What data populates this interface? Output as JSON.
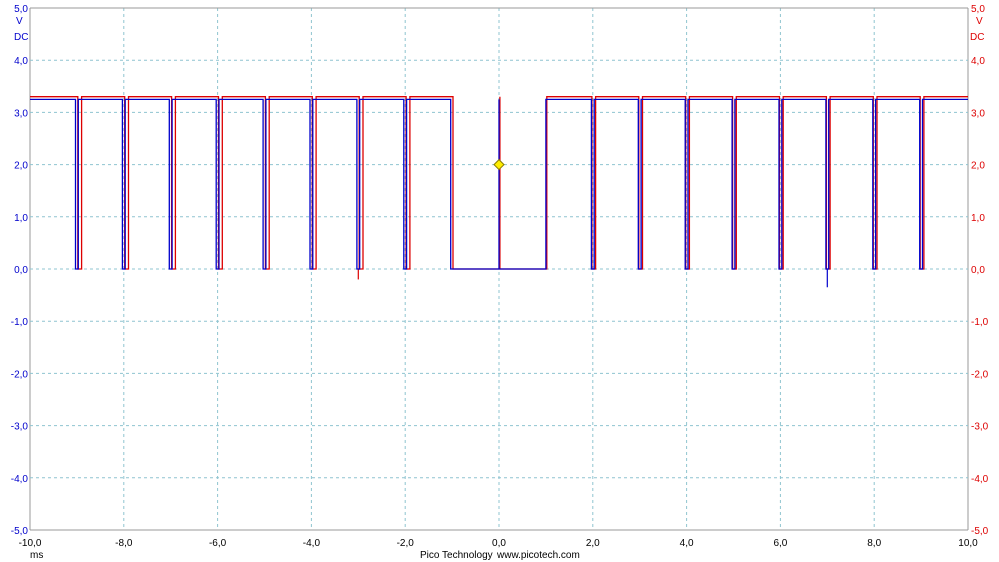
{
  "chart_data": {
    "type": "line",
    "x_unit": "ms",
    "xlim": [
      -10.0,
      10.0
    ],
    "ylim": [
      -5.0,
      5.0
    ],
    "x_ticks": [
      "-10,0",
      "-8,0",
      "-6,0",
      "-4,0",
      "-2,0",
      "0,0",
      "2,0",
      "4,0",
      "6,0",
      "8,0",
      "10,0"
    ],
    "y_ticks": [
      "5,0",
      "4,0",
      "3,0",
      "2,0",
      "1,0",
      "0,0",
      "-1,0",
      "-2,0",
      "-3,0",
      "-4,0",
      "-5,0"
    ],
    "left_axis": {
      "unit": "V",
      "coupling": "DC",
      "color": "#0000cc"
    },
    "right_axis": {
      "unit": "V",
      "coupling": "DC",
      "color": "#dd0000"
    },
    "grid": true,
    "footer": {
      "brand": "Pico Technology",
      "url": "www.picotech.com"
    },
    "trigger": {
      "x": 0.0,
      "y": 2.0,
      "color": "#ffee00"
    },
    "series": [
      {
        "color": "#0000cc",
        "high": 3.25,
        "low": 0.0,
        "low_intervals": [
          [
            -9.03,
            -8.97
          ],
          [
            -8.03,
            -7.97
          ],
          [
            -7.03,
            -6.97
          ],
          [
            -6.03,
            -5.97
          ],
          [
            -5.03,
            -4.97
          ],
          [
            -4.03,
            -3.97
          ],
          [
            -3.03,
            -2.97
          ],
          [
            -2.03,
            -1.97
          ],
          [
            -1.03,
            0.0
          ],
          [
            0.0,
            1.0
          ],
          [
            1.97,
            2.03
          ],
          [
            2.97,
            3.03
          ],
          [
            3.97,
            4.03
          ],
          [
            4.97,
            5.03
          ],
          [
            5.97,
            6.03
          ],
          [
            6.97,
            7.03
          ],
          [
            7.97,
            8.03
          ],
          [
            8.97,
            9.03
          ]
        ],
        "glitch": {
          "x": 7.0,
          "y": -0.35
        }
      },
      {
        "color": "#dd0000",
        "high": 3.3,
        "low": 0.0,
        "low_intervals": [
          [
            -8.98,
            -8.9
          ],
          [
            -7.98,
            -7.9
          ],
          [
            -6.98,
            -6.9
          ],
          [
            -5.98,
            -5.9
          ],
          [
            -4.98,
            -4.9
          ],
          [
            -3.98,
            -3.9
          ],
          [
            -2.98,
            -2.9
          ],
          [
            -1.98,
            -1.9
          ],
          [
            -0.98,
            0.02
          ],
          [
            0.02,
            1.02
          ],
          [
            1.98,
            2.06
          ],
          [
            2.98,
            3.06
          ],
          [
            3.98,
            4.06
          ],
          [
            4.98,
            5.06
          ],
          [
            5.98,
            6.06
          ],
          [
            6.98,
            7.06
          ],
          [
            7.98,
            8.06
          ],
          [
            8.98,
            9.06
          ]
        ],
        "glitch": {
          "x": -3.0,
          "y": -0.2
        }
      }
    ]
  }
}
